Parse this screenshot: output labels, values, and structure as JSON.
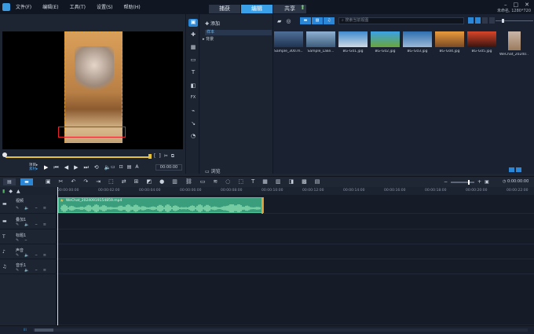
{
  "menu": {
    "items": [
      "文件(F)",
      "编辑(E)",
      "工具(T)",
      "设置(S)",
      "帮助(H)"
    ]
  },
  "mode_tabs": {
    "capture": "捕获",
    "edit": "编辑",
    "share": "共享"
  },
  "project": {
    "info": "未命名, 1280*720"
  },
  "player": {
    "mode_project": "项目▸",
    "mode_clip": "素材▸",
    "timecode": "00:00:00",
    "snap_labels": "[ ]"
  },
  "library": {
    "add_label": "添加",
    "tree_sample": "样本",
    "tree_background": "背景",
    "browse_label": "浏览",
    "search_placeholder": "搜索当前视图",
    "thumbnails": [
      {
        "label": "Sample_300.m...",
        "color_top": "#4f6f99",
        "color_bottom": "#1f3451"
      },
      {
        "label": "Sample_Lake...",
        "color_top": "#8fb0d3",
        "color_bottom": "#3e5c7a"
      },
      {
        "label": "BG-G01.jpg",
        "color_top": "#3f8ad0",
        "color_bottom": "#cfd9e2"
      },
      {
        "label": "BG-G02.jpg",
        "color_top": "#3aa1e6",
        "color_bottom": "#6aa63a"
      },
      {
        "label": "BG-G03.jpg",
        "color_top": "#2e6fb0",
        "color_bottom": "#9ab9d6"
      },
      {
        "label": "BG-G04.jpg",
        "color_top": "#e99b3c",
        "color_bottom": "#7a4a25"
      },
      {
        "label": "BG-G05.jpg",
        "color_top": "#d8452a",
        "color_bottom": "#3a1410"
      },
      {
        "label": "WeChat_20240...",
        "color_top": "#c9b6a8",
        "color_bottom": "#9c7b5d"
      }
    ]
  },
  "timeline": {
    "timecode": "0:00:00:00",
    "ruler_ticks": [
      "00:00:00:00",
      "00:00:02:00",
      "00:00:04:00",
      "00:00:06:00",
      "00:00:08:00",
      "00:00:10:00",
      "00:00:12:00",
      "00:00:14:00",
      "00:00:16:00",
      "00:00:18:00",
      "00:00:20:00",
      "00:00:22:00"
    ],
    "tracks": [
      {
        "name": "视频",
        "icon": "video-track-icon"
      },
      {
        "name": "叠加1",
        "icon": "overlay-track-icon"
      },
      {
        "name": "标题1",
        "icon": "title-track-icon"
      },
      {
        "name": "声音",
        "icon": "voice-track-icon"
      },
      {
        "name": "音乐1",
        "icon": "music-track-icon"
      }
    ],
    "clip_title": "WeChat_20240919154859.mp4"
  },
  "status": {
    "label": "lll"
  },
  "colors": {
    "accent": "#3aa0e8",
    "clip": "#3a9d7b",
    "crop_outline": "#e8232a",
    "scrub": "#e6c13b"
  }
}
